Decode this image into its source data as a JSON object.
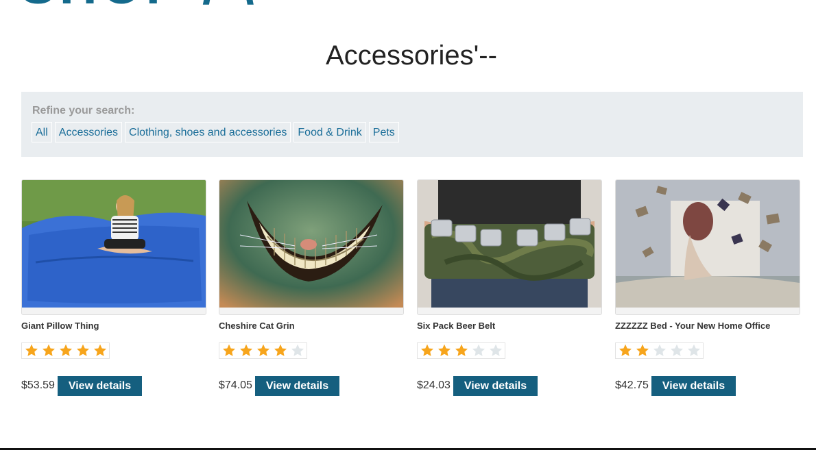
{
  "header": {
    "logo_text": "SHOP / \\",
    "page_title": "Accessories'--"
  },
  "filters": {
    "label": "Refine your search:",
    "items": [
      "All",
      "Accessories",
      "Clothing, shoes and accessories",
      "Food & Drink",
      "Pets"
    ]
  },
  "products": [
    {
      "name": "Giant Pillow Thing",
      "rating": 5,
      "max_rating": 5,
      "price": "$53.59",
      "button": "View details"
    },
    {
      "name": "Cheshire Cat Grin",
      "rating": 4,
      "max_rating": 5,
      "price": "$74.05",
      "button": "View details"
    },
    {
      "name": "Six Pack Beer Belt",
      "rating": 3,
      "max_rating": 5,
      "price": "$24.03",
      "button": "View details"
    },
    {
      "name": "ZZZZZZ Bed - Your New Home Office",
      "rating": 2,
      "max_rating": 5,
      "price": "$42.75",
      "button": "View details"
    }
  ],
  "colors": {
    "brand": "#146a8c",
    "button": "#155f7f",
    "link": "#1b6e99",
    "star_on": "#f7a51c",
    "star_off": "#dfe5e8",
    "filter_bg": "#e9edf0"
  }
}
